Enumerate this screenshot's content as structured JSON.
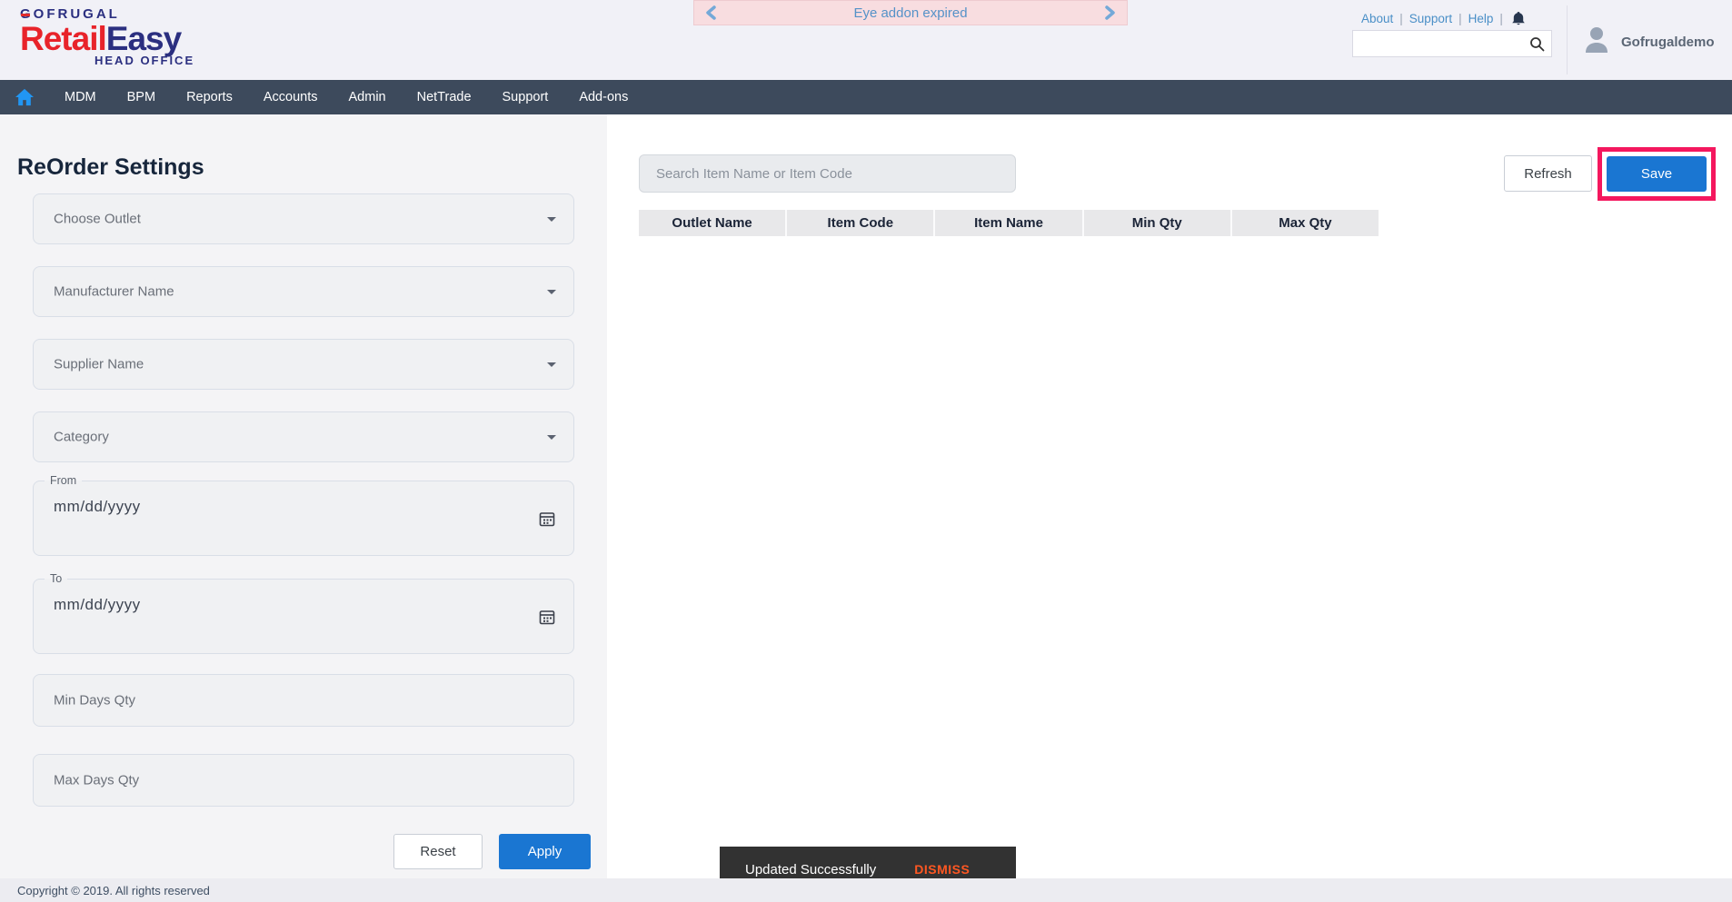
{
  "header": {
    "logo": {
      "brand": "GOFRUGAL",
      "product_red": "Retail",
      "product_navy": "Easy",
      "suffix": "HEAD OFFICE"
    },
    "banner": {
      "text": "Eye addon expired"
    },
    "links": {
      "about": "About",
      "support": "Support",
      "help": "Help",
      "separator": "|"
    },
    "search": {
      "value": "",
      "placeholder": ""
    },
    "user": {
      "name": "Gofrugaldemo"
    }
  },
  "nav": {
    "items": [
      "MDM",
      "BPM",
      "Reports",
      "Accounts",
      "Admin",
      "NetTrade",
      "Support",
      "Add-ons"
    ]
  },
  "sidebar": {
    "title": "ReOrder Settings",
    "dropdowns": [
      "Choose Outlet",
      "Manufacturer Name",
      "Supplier Name",
      "Category"
    ],
    "date_fields": [
      {
        "label": "From",
        "value": "mm/dd/yyyy"
      },
      {
        "label": "To",
        "value": "mm/dd/yyyy"
      }
    ],
    "qty_fields": [
      "Min Days Qty",
      "Max Days Qty"
    ],
    "reset_label": "Reset",
    "apply_label": "Apply"
  },
  "main": {
    "search_placeholder": "Search Item Name or Item Code",
    "refresh_label": "Refresh",
    "save_label": "Save",
    "table_headers": [
      "Outlet Name",
      "Item Code",
      "Item Name",
      "Min Qty",
      "Max Qty"
    ]
  },
  "snackbar": {
    "message": "Updated Successfully",
    "action": "DISMISS"
  },
  "footer": {
    "copyright": "Copyright © 2019. All rights reserved"
  },
  "icons": {
    "home": "home-icon",
    "bell": "bell-icon",
    "search": "search-icon",
    "avatar": "avatar-icon",
    "calendar": "calendar-icon",
    "caret": "caret-down-icon",
    "banner_prev": "chevron-left-icon",
    "banner_next": "chevron-right-icon"
  },
  "colors": {
    "primary_blue": "#1a76d2",
    "nav_bar": "#3d4a5c",
    "home_icon_blue": "#2196f3",
    "save_highlight_pink": "#f4175e",
    "banner_background": "#f8dde0",
    "banner_text_blue": "#5592c8",
    "snackbar_background": "#323232",
    "snackbar_action_orange": "#ff5722",
    "logo_red": "#e8232a",
    "logo_navy": "#2b2f80"
  }
}
